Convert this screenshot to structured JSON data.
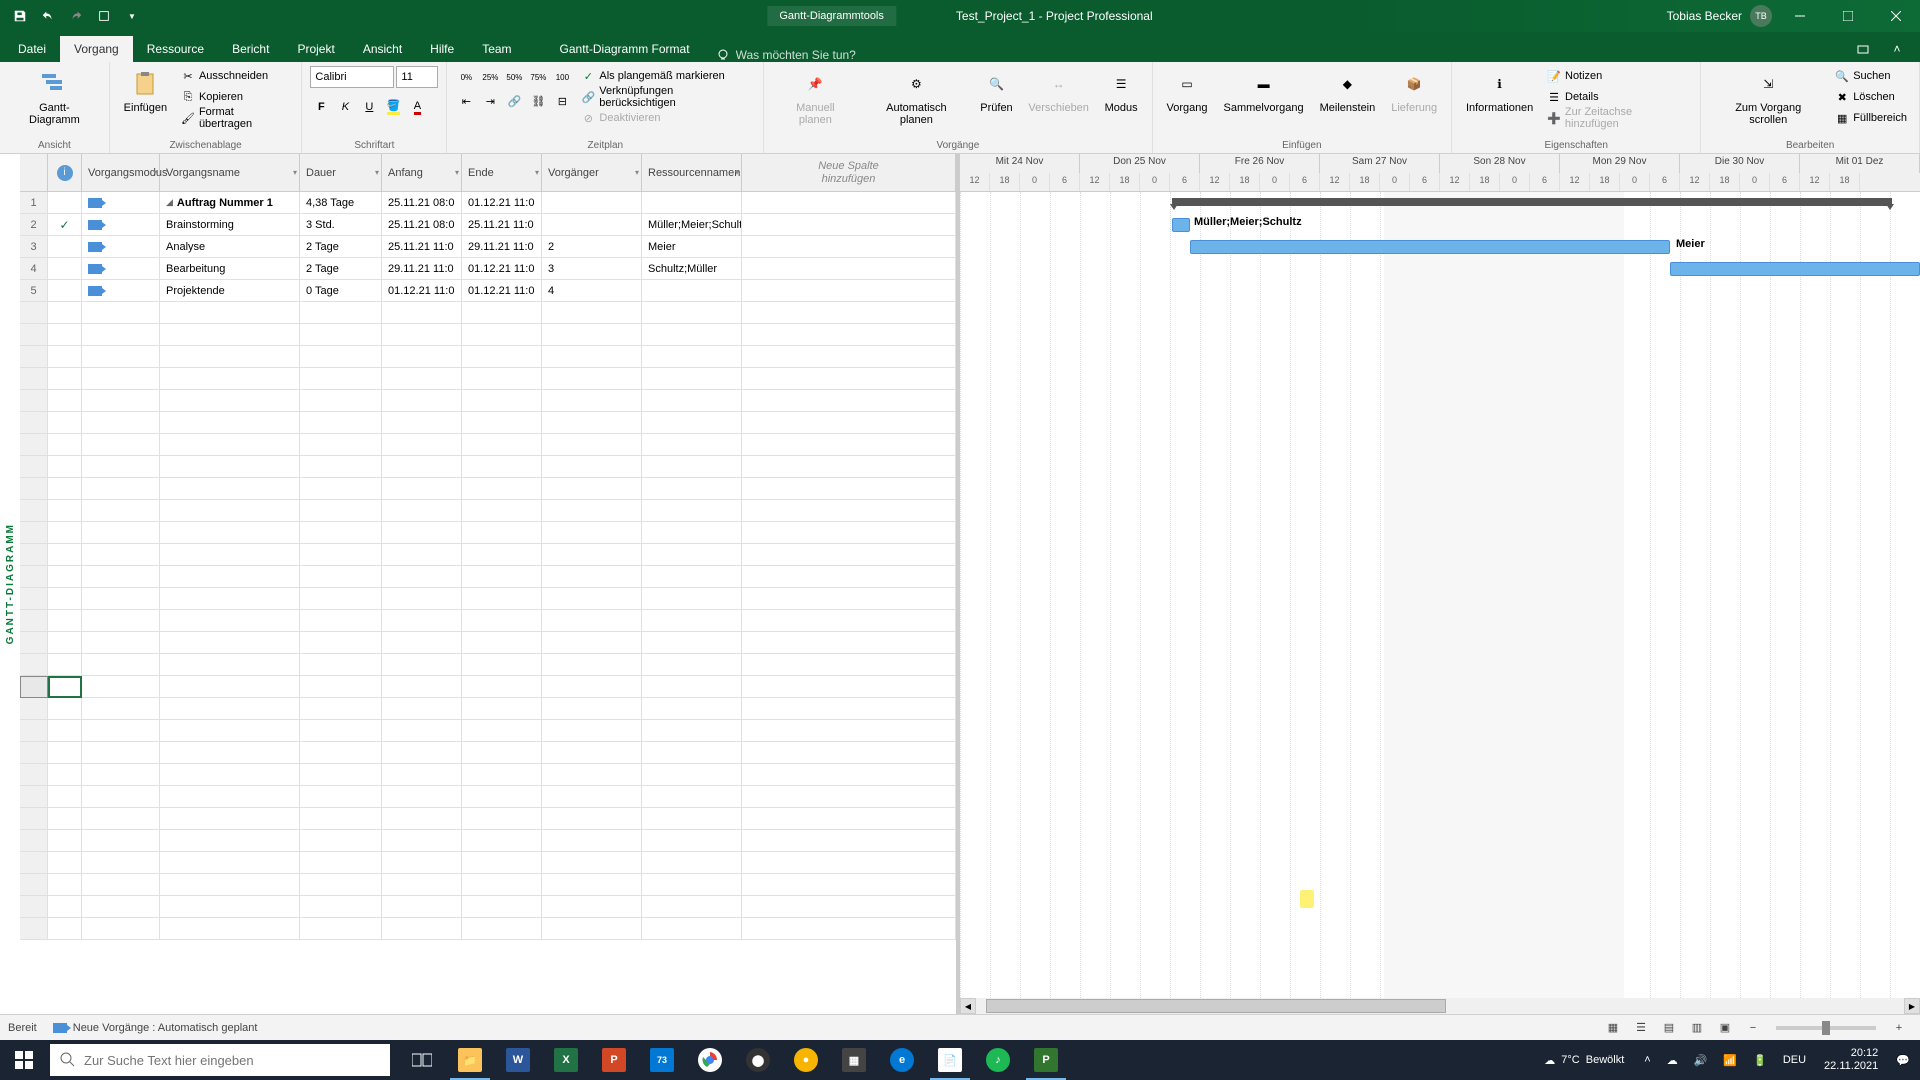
{
  "title_bar": {
    "tool_tab": "Gantt-Diagrammtools",
    "doc_title": "Test_Project_1  -  Project Professional",
    "user_name": "Tobias Becker",
    "user_initials": "TB"
  },
  "ribbon_tabs": {
    "file": "Datei",
    "vorgang": "Vorgang",
    "ressource": "Ressource",
    "bericht": "Bericht",
    "projekt": "Projekt",
    "ansicht": "Ansicht",
    "hilfe": "Hilfe",
    "team": "Team",
    "format": "Gantt-Diagramm Format",
    "tell_me_placeholder": "Was möchten Sie tun?"
  },
  "ribbon": {
    "ansicht": {
      "gantt": "Gantt-Diagramm",
      "label": "Ansicht"
    },
    "clipboard": {
      "einfuegen": "Einfügen",
      "ausschneiden": "Ausschneiden",
      "kopieren": "Kopieren",
      "format_uebertragen": "Format übertragen",
      "label": "Zwischenablage"
    },
    "font": {
      "name": "Calibri",
      "size": "11",
      "label": "Schriftart"
    },
    "schedule": {
      "als_plan": "Als plangemäß markieren",
      "verk": "Verknüpfungen berücksichtigen",
      "deakt": "Deaktivieren",
      "label": "Zeitplan"
    },
    "tasks": {
      "manuell": "Manuell planen",
      "auto": "Automatisch planen",
      "pruefen": "Prüfen",
      "verschieben": "Verschieben",
      "modus": "Modus",
      "label": "Vorgänge"
    },
    "insert": {
      "vorgang": "Vorgang",
      "sammel": "Sammelvorgang",
      "meilenstein": "Meilenstein",
      "lieferung": "Lieferung",
      "label": "Einfügen"
    },
    "props": {
      "info": "Informationen",
      "notizen": "Notizen",
      "details": "Details",
      "zeitachse": "Zur Zeitachse hinzufügen",
      "label": "Eigenschaften"
    },
    "edit": {
      "scroll": "Zum Vorgang scrollen",
      "suchen": "Suchen",
      "loeschen": "Löschen",
      "fuellbereich": "Füllbereich",
      "label": "Bearbeiten"
    }
  },
  "columns": {
    "info": "ⓘ",
    "mode": "Vorgangsmodus",
    "name": "Vorgangsname",
    "duration": "Dauer",
    "start": "Anfang",
    "end": "Ende",
    "pred": "Vorgänger",
    "res": "Ressourcennamen",
    "new1": "Neue Spalte",
    "new2": "hinzufügen"
  },
  "tasks": [
    {
      "row": "1",
      "check": false,
      "name": "Auftrag Nummer 1",
      "bold": true,
      "outline": true,
      "dur": "4,38 Tage",
      "start": "25.11.21 08:0",
      "end": "01.12.21 11:0",
      "pred": "",
      "res": ""
    },
    {
      "row": "2",
      "check": true,
      "name": "Brainstorming",
      "bold": false,
      "outline": false,
      "dur": "3 Std.",
      "start": "25.11.21 08:0",
      "end": "25.11.21 11:0",
      "pred": "",
      "res": "Müller;Meier;Schultz"
    },
    {
      "row": "3",
      "check": false,
      "name": "Analyse",
      "bold": false,
      "outline": false,
      "dur": "2 Tage",
      "start": "25.11.21 11:0",
      "end": "29.11.21 11:0",
      "pred": "2",
      "res": "Meier"
    },
    {
      "row": "4",
      "check": false,
      "name": "Bearbeitung",
      "bold": false,
      "outline": false,
      "dur": "2 Tage",
      "start": "29.11.21 11:0",
      "end": "01.12.21 11:0",
      "pred": "3",
      "res": "Schultz;Müller"
    },
    {
      "row": "5",
      "check": false,
      "name": "Projektende",
      "bold": false,
      "outline": false,
      "dur": "0 Tage",
      "start": "01.12.21 11:0",
      "end": "01.12.21 11:0",
      "pred": "4",
      "res": ""
    }
  ],
  "gantt": {
    "days": [
      "Mit 24 Nov",
      "Don 25 Nov",
      "Fre 26 Nov",
      "Sam 27 Nov",
      "Son 28 Nov",
      "Mon 29 Nov",
      "Die 30 Nov",
      "Mit 01 Dez"
    ],
    "hours": [
      "12",
      "18",
      "0",
      "6",
      "12",
      "18",
      "0",
      "6",
      "12",
      "18",
      "0",
      "6",
      "12",
      "18",
      "0",
      "6",
      "12",
      "18",
      "0",
      "6",
      "12",
      "18",
      "0",
      "6",
      "12",
      "18",
      "0",
      "6",
      "12",
      "18"
    ],
    "labels": {
      "bar2": "Müller;Meier;Schultz",
      "bar3": "Meier"
    }
  },
  "side_label": "GANTT-DIAGRAMM",
  "status": {
    "ready": "Bereit",
    "sched": "Neue Vorgänge : Automatisch geplant"
  },
  "taskbar": {
    "search_placeholder": "Zur Suche Text hier eingeben",
    "weather_temp": "7°C",
    "weather_cond": "Bewölkt",
    "lang": "DEU",
    "time": "20:12",
    "date": "22.11.2021"
  }
}
